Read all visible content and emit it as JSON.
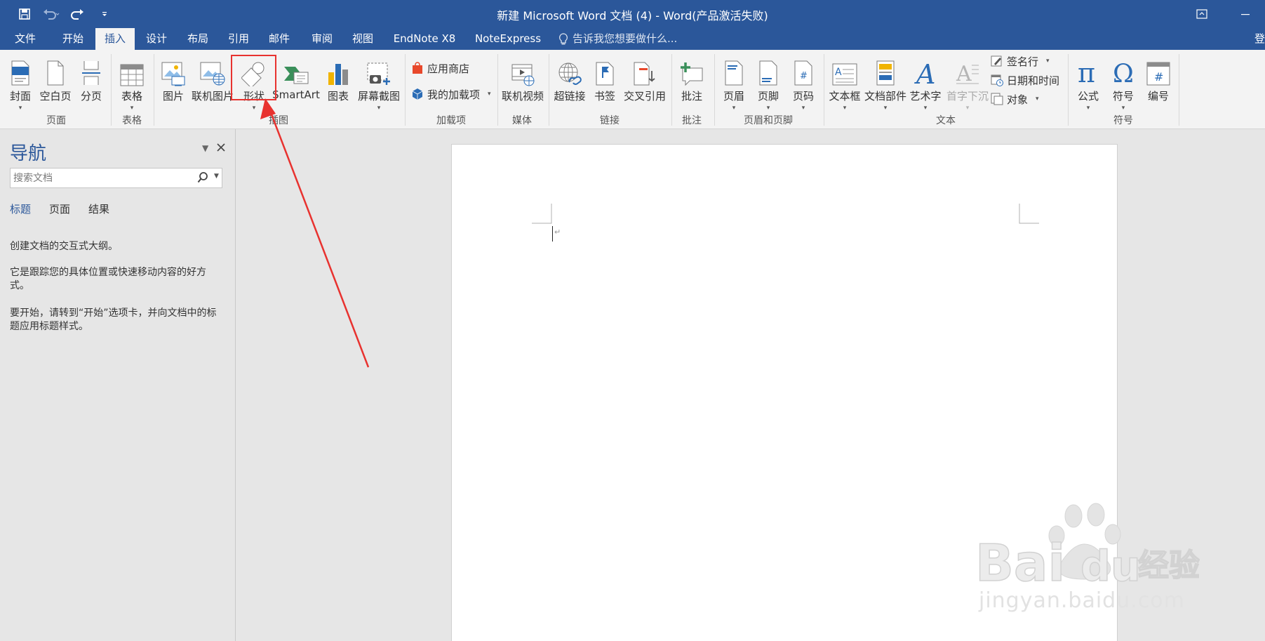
{
  "window": {
    "title": "新建 Microsoft Word 文档 (4) - Word(产品激活失败)"
  },
  "tabs": [
    {
      "label": "文件"
    },
    {
      "label": "开始"
    },
    {
      "label": "插入"
    },
    {
      "label": "设计"
    },
    {
      "label": "布局"
    },
    {
      "label": "引用"
    },
    {
      "label": "邮件"
    },
    {
      "label": "审阅"
    },
    {
      "label": "视图"
    },
    {
      "label": "EndNote X8"
    },
    {
      "label": "NoteExpress"
    }
  ],
  "active_tab": "插入",
  "tell_me": "告诉我您想要做什么...",
  "tab_edge_fragment": "登",
  "ribbon": {
    "buttons": {
      "cover": "封面",
      "blank_page": "空白页",
      "page_break": "分页",
      "table": "表格",
      "picture": "图片",
      "online_picture": "联机图片",
      "shapes": "形状",
      "smartart": "SmartArt",
      "chart": "图表",
      "screenshot": "屏幕截图",
      "store": "应用商店",
      "my_addins": "我的加载项",
      "online_video": "联机视频",
      "hyperlink": "超链接",
      "bookmark": "书签",
      "cross_reference": "交叉引用",
      "comment": "批注",
      "header": "页眉",
      "footer": "页脚",
      "page_number": "页码",
      "text_box": "文本框",
      "quick_parts": "文档部件",
      "wordart": "艺术字",
      "drop_cap": "首字下沉",
      "signature_line": "签名行",
      "date_time": "日期和时间",
      "object": "对象",
      "equation": "公式",
      "symbol": "符号",
      "numbering": "编号"
    },
    "groups": {
      "pages": "页面",
      "tables": "表格",
      "illustrations": "插图",
      "addins": "加载项",
      "media": "媒体",
      "links": "链接",
      "comments": "批注",
      "header_footer": "页眉和页脚",
      "text": "文本",
      "symbols": "符号"
    }
  },
  "nav": {
    "title": "导航",
    "search_placeholder": "搜索文档",
    "tabs": [
      "标题",
      "页面",
      "结果"
    ],
    "active_tab": "标题",
    "text1": "创建文档的交互式大纲。",
    "text2": "它是跟踪您的具体位置或快速移动内容的好方式。",
    "text3": "要开始，请转到“开始”选项卡，并向文档中的标题应用标题样式。"
  },
  "colors": {
    "accent": "#2b579a",
    "annotation_red": "#e8322f"
  }
}
